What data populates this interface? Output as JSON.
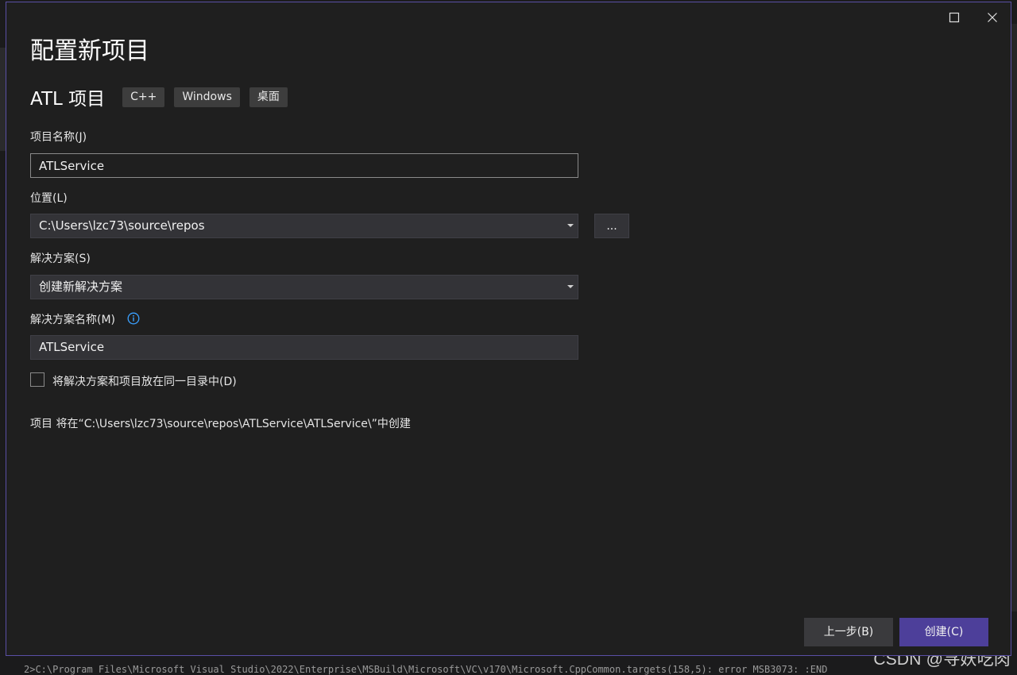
{
  "dialog": {
    "title": "配置新项目",
    "template_name": "ATL 项目",
    "tags": [
      "C++",
      "Windows",
      "桌面"
    ]
  },
  "form": {
    "project_name_label": "项目名称(J)",
    "project_name_value": "ATLService",
    "location_label": "位置(L)",
    "location_value": "C:\\Users\\lzc73\\source\\repos",
    "browse_label": "...",
    "solution_label": "解决方案(S)",
    "solution_value": "创建新解决方案",
    "solution_name_label": "解决方案名称(M)",
    "solution_name_value": "ATLService",
    "same_dir_label": "将解决方案和项目放在同一目录中(D)",
    "same_dir_checked": false,
    "path_note": "项目 将在“C:\\Users\\lzc73\\source\\repos\\ATLService\\ATLService\\”中创建"
  },
  "buttons": {
    "back_label": "上一步(B)",
    "create_label": "创建(C)"
  },
  "background": {
    "output_text": "2>C:\\Program Files\\Microsoft Visual Studio\\2022\\Enterprise\\MSBuild\\Microsoft\\VC\\v170\\Microsoft.CppCommon.targets(158,5): error MSB3073: :END",
    "watermark": "CSDN @寻妖吃肉"
  },
  "colors": {
    "accent": "#4d3f9a",
    "dialog_border": "#5a4fa5",
    "info_icon": "#3aa0ff"
  }
}
